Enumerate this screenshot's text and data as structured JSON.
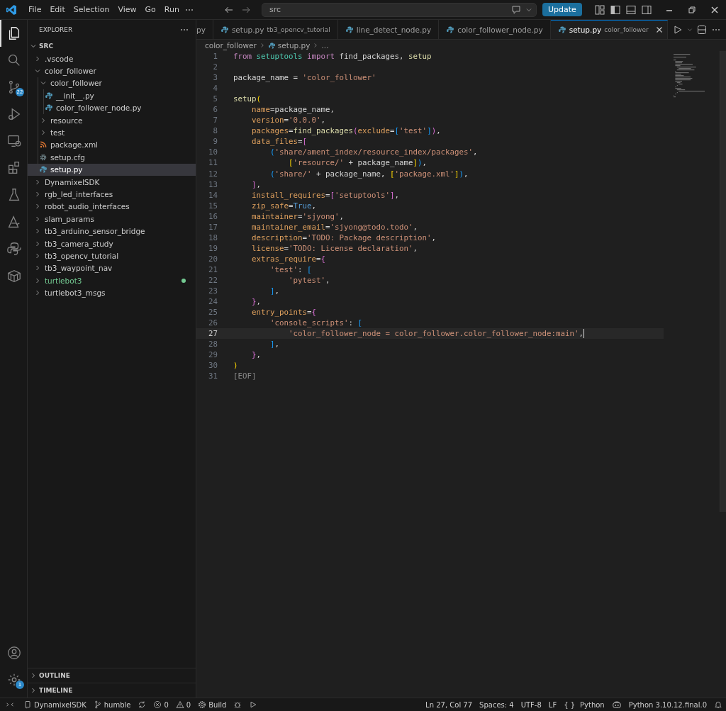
{
  "menu": [
    "File",
    "Edit",
    "Selection",
    "View",
    "Go",
    "Run"
  ],
  "command_center": {
    "value": "src"
  },
  "update_button": "Update",
  "activity_bar": {
    "top": [
      {
        "kind": "explorer",
        "selected": true
      },
      {
        "kind": "search",
        "selected": false
      },
      {
        "kind": "source-control",
        "selected": false,
        "badge": "22"
      },
      {
        "kind": "run-debug",
        "selected": false
      },
      {
        "kind": "remote",
        "selected": false
      },
      {
        "kind": "extensions",
        "selected": false
      },
      {
        "kind": "testing",
        "selected": false
      },
      {
        "kind": "ai",
        "selected": false
      },
      {
        "kind": "python",
        "selected": false
      },
      {
        "kind": "container",
        "selected": false
      }
    ],
    "bottom": [
      {
        "kind": "account",
        "selected": false
      },
      {
        "kind": "settings",
        "selected": false,
        "badge": "1"
      }
    ]
  },
  "explorer": {
    "title": "EXPLORER",
    "section": "SRC",
    "expanded": true,
    "items": [
      {
        "label": ".vscode",
        "kind": "folder",
        "expanded": false,
        "selected": false,
        "modified": false
      },
      {
        "label": "color_follower",
        "kind": "folder",
        "expanded": true,
        "selected": false,
        "modified": false,
        "children": [
          {
            "label": "color_follower",
            "kind": "folder",
            "expanded": true,
            "selected": false,
            "modified": false,
            "children": [
              {
                "label": "__init__.py",
                "kind": "python",
                "selected": false,
                "modified": false
              },
              {
                "label": "color_follower_node.py",
                "kind": "python",
                "selected": false,
                "modified": false
              }
            ]
          },
          {
            "label": "resource",
            "kind": "folder",
            "expanded": false,
            "selected": false,
            "modified": false
          },
          {
            "label": "test",
            "kind": "folder",
            "expanded": false,
            "selected": false,
            "modified": false
          },
          {
            "label": "package.xml",
            "kind": "xml",
            "selected": false,
            "modified": false
          },
          {
            "label": "setup.cfg",
            "kind": "config",
            "selected": false,
            "modified": false
          },
          {
            "label": "setup.py",
            "kind": "python",
            "selected": true,
            "modified": false
          }
        ]
      },
      {
        "label": "DynamixelSDK",
        "kind": "folder",
        "expanded": false,
        "selected": false,
        "modified": false
      },
      {
        "label": "rgb_led_interfaces",
        "kind": "folder",
        "expanded": false,
        "selected": false,
        "modified": false
      },
      {
        "label": "robot_audio_interfaces",
        "kind": "folder",
        "expanded": false,
        "selected": false,
        "modified": false
      },
      {
        "label": "slam_params",
        "kind": "folder",
        "expanded": false,
        "selected": false,
        "modified": false
      },
      {
        "label": "tb3_arduino_sensor_bridge",
        "kind": "folder",
        "expanded": false,
        "selected": false,
        "modified": false
      },
      {
        "label": "tb3_camera_study",
        "kind": "folder",
        "expanded": false,
        "selected": false,
        "modified": false
      },
      {
        "label": "tb3_opencv_tutorial",
        "kind": "folder",
        "expanded": false,
        "selected": false,
        "modified": false
      },
      {
        "label": "tb3_waypoint_nav",
        "kind": "folder",
        "expanded": false,
        "selected": false,
        "modified": false
      },
      {
        "label": "turtlebot3",
        "kind": "folder",
        "expanded": false,
        "selected": false,
        "modified": true
      },
      {
        "label": "turtlebot3_msgs",
        "kind": "folder",
        "expanded": false,
        "selected": false,
        "modified": false
      }
    ]
  },
  "panels": [
    {
      "label": "OUTLINE",
      "expanded": false
    },
    {
      "label": "TIMELINE",
      "expanded": false
    }
  ],
  "tabs": [
    {
      "label": "py",
      "icon": false,
      "selected": false
    },
    {
      "label": "setup.py",
      "description": "tb3_opencv_tutorial",
      "icon": true,
      "selected": false
    },
    {
      "label": "line_detect_node.py",
      "icon": true,
      "selected": false
    },
    {
      "label": "color_follower_node.py",
      "icon": true,
      "selected": false
    },
    {
      "label": "setup.py",
      "description": "color_follower",
      "icon": true,
      "selected": true
    }
  ],
  "breadcrumb": [
    "color_follower",
    "setup.py",
    "..."
  ],
  "code": [
    {
      "n": "1",
      "tokens": [
        {
          "t": "from ",
          "kind": "kw"
        },
        {
          "t": "setuptools ",
          "kind": "mod"
        },
        {
          "t": "import ",
          "kind": "kw"
        },
        {
          "t": "find_packages, ",
          "kind": "p"
        },
        {
          "t": "setup",
          "kind": "fn"
        }
      ]
    },
    {
      "n": "2"
    },
    {
      "n": "3",
      "tokens": [
        {
          "t": "package_name = ",
          "kind": "p"
        },
        {
          "t": "'color_follower'",
          "kind": "str"
        }
      ]
    },
    {
      "n": "4"
    },
    {
      "n": "5",
      "tokens": [
        {
          "t": "setup",
          "kind": "fn"
        },
        {
          "t": "(",
          "kind": "b1"
        }
      ]
    },
    {
      "n": "6",
      "tokens": [
        {
          "t": "    name",
          "kind": "param"
        },
        {
          "t": "=package_name,",
          "kind": "p"
        }
      ]
    },
    {
      "n": "7",
      "tokens": [
        {
          "t": "    version",
          "kind": "param"
        },
        {
          "t": "=",
          "kind": "p"
        },
        {
          "t": "'0.0.0'",
          "kind": "str"
        },
        {
          "t": ",",
          "kind": "p"
        }
      ]
    },
    {
      "n": "8",
      "tokens": [
        {
          "t": "    packages",
          "kind": "param"
        },
        {
          "t": "=",
          "kind": "p"
        },
        {
          "t": "find_packages",
          "kind": "fn"
        },
        {
          "t": "(",
          "kind": "b2"
        },
        {
          "t": "exclude",
          "kind": "param"
        },
        {
          "t": "=",
          "kind": "p"
        },
        {
          "t": "[",
          "kind": "b3"
        },
        {
          "t": "'test'",
          "kind": "str"
        },
        {
          "t": "]",
          "kind": "b3"
        },
        {
          "t": ")",
          "kind": "b2"
        },
        {
          "t": ",",
          "kind": "p"
        }
      ]
    },
    {
      "n": "9",
      "tokens": [
        {
          "t": "    data_files",
          "kind": "param"
        },
        {
          "t": "=",
          "kind": "p"
        },
        {
          "t": "[",
          "kind": "b2"
        }
      ]
    },
    {
      "n": "10",
      "tokens": [
        {
          "t": "        (",
          "kind": "b3"
        },
        {
          "t": "'share/ament_index/resource_index/packages'",
          "kind": "str"
        },
        {
          "t": ",",
          "kind": "p"
        }
      ]
    },
    {
      "n": "11",
      "tokens": [
        {
          "t": "            [",
          "kind": "b1"
        },
        {
          "t": "'resource/'",
          "kind": "str"
        },
        {
          "t": " + package_name",
          "kind": "p"
        },
        {
          "t": "]",
          "kind": "b1"
        },
        {
          "t": ")",
          "kind": "b3"
        },
        {
          "t": ",",
          "kind": "p"
        }
      ]
    },
    {
      "n": "12",
      "tokens": [
        {
          "t": "        (",
          "kind": "b3"
        },
        {
          "t": "'share/'",
          "kind": "str"
        },
        {
          "t": " + package_name, ",
          "kind": "p"
        },
        {
          "t": "[",
          "kind": "b1"
        },
        {
          "t": "'package.xml'",
          "kind": "str"
        },
        {
          "t": "]",
          "kind": "b1"
        },
        {
          "t": ")",
          "kind": "b3"
        },
        {
          "t": ",",
          "kind": "p"
        }
      ]
    },
    {
      "n": "13",
      "tokens": [
        {
          "t": "    ]",
          "kind": "b2"
        },
        {
          "t": ",",
          "kind": "p"
        }
      ]
    },
    {
      "n": "14",
      "tokens": [
        {
          "t": "    install_requires",
          "kind": "param"
        },
        {
          "t": "=",
          "kind": "p"
        },
        {
          "t": "[",
          "kind": "b2"
        },
        {
          "t": "'setuptools'",
          "kind": "str"
        },
        {
          "t": "]",
          "kind": "b2"
        },
        {
          "t": ",",
          "kind": "p"
        }
      ]
    },
    {
      "n": "15",
      "tokens": [
        {
          "t": "    zip_safe",
          "kind": "param"
        },
        {
          "t": "=",
          "kind": "p"
        },
        {
          "t": "True",
          "kind": "const"
        },
        {
          "t": ",",
          "kind": "p"
        }
      ]
    },
    {
      "n": "16",
      "tokens": [
        {
          "t": "    maintainer",
          "kind": "param"
        },
        {
          "t": "=",
          "kind": "p"
        },
        {
          "t": "'sjyong'",
          "kind": "str"
        },
        {
          "t": ",",
          "kind": "p"
        }
      ]
    },
    {
      "n": "17",
      "tokens": [
        {
          "t": "    maintainer_email",
          "kind": "param"
        },
        {
          "t": "=",
          "kind": "p"
        },
        {
          "t": "'sjyong@todo.todo'",
          "kind": "str"
        },
        {
          "t": ",",
          "kind": "p"
        }
      ]
    },
    {
      "n": "18",
      "tokens": [
        {
          "t": "    description",
          "kind": "param"
        },
        {
          "t": "=",
          "kind": "p"
        },
        {
          "t": "'TODO: Package description'",
          "kind": "str"
        },
        {
          "t": ",",
          "kind": "p"
        }
      ]
    },
    {
      "n": "19",
      "tokens": [
        {
          "t": "    license",
          "kind": "param"
        },
        {
          "t": "=",
          "kind": "p"
        },
        {
          "t": "'TODO: License declaration'",
          "kind": "str"
        },
        {
          "t": ",",
          "kind": "p"
        }
      ]
    },
    {
      "n": "20",
      "tokens": [
        {
          "t": "    extras_require",
          "kind": "param"
        },
        {
          "t": "=",
          "kind": "p"
        },
        {
          "t": "{",
          "kind": "b2"
        }
      ]
    },
    {
      "n": "21",
      "tokens": [
        {
          "t": "        'test'",
          "kind": "str"
        },
        {
          "t": ": ",
          "kind": "p"
        },
        {
          "t": "[",
          "kind": "b3"
        }
      ]
    },
    {
      "n": "22",
      "tokens": [
        {
          "t": "            'pytest'",
          "kind": "str"
        },
        {
          "t": ",",
          "kind": "p"
        }
      ]
    },
    {
      "n": "23",
      "tokens": [
        {
          "t": "        ]",
          "kind": "b3"
        },
        {
          "t": ",",
          "kind": "p"
        }
      ]
    },
    {
      "n": "24",
      "tokens": [
        {
          "t": "    }",
          "kind": "b2"
        },
        {
          "t": ",",
          "kind": "p"
        }
      ]
    },
    {
      "n": "25",
      "tokens": [
        {
          "t": "    entry_points",
          "kind": "param"
        },
        {
          "t": "=",
          "kind": "p"
        },
        {
          "t": "{",
          "kind": "b2"
        }
      ]
    },
    {
      "n": "26",
      "tokens": [
        {
          "t": "        'console_scripts'",
          "kind": "str"
        },
        {
          "t": ": ",
          "kind": "p"
        },
        {
          "t": "[",
          "kind": "b3"
        }
      ]
    },
    {
      "n": "27",
      "current": true,
      "tokens": [
        {
          "t": "            'color_follower_node = color_follower.color_follower_node:main'",
          "kind": "str"
        },
        {
          "t": ",",
          "kind": "p"
        }
      ]
    },
    {
      "n": "28",
      "tokens": [
        {
          "t": "        ]",
          "kind": "b3"
        },
        {
          "t": ",",
          "kind": "p"
        }
      ]
    },
    {
      "n": "29",
      "tokens": [
        {
          "t": "    }",
          "kind": "b2"
        },
        {
          "t": ",",
          "kind": "p"
        }
      ]
    },
    {
      "n": "30",
      "tokens": [
        {
          "t": ")",
          "kind": "b1"
        }
      ]
    },
    {
      "n": "31",
      "tokens": [
        {
          "t": "[EOF]",
          "kind": "eof"
        }
      ]
    }
  ],
  "status_bar": {
    "left": [
      {
        "kind": "remote"
      },
      {
        "kind": "folder",
        "text": "DynamixelSDK"
      },
      {
        "kind": "branch",
        "text": "humble"
      },
      {
        "kind": "sync"
      },
      {
        "kind": "errors",
        "text": "0"
      },
      {
        "kind": "warnings",
        "text": "0"
      },
      {
        "kind": "build",
        "text": "Build"
      },
      {
        "kind": "debug"
      },
      {
        "kind": "run"
      }
    ],
    "right": [
      {
        "kind": "text",
        "text": "Ln 27, Col 77"
      },
      {
        "kind": "text",
        "text": "Spaces: 4"
      },
      {
        "kind": "text",
        "text": "UTF-8"
      },
      {
        "kind": "text",
        "text": "LF"
      },
      {
        "kind": "language",
        "brace": "{ }",
        "text": "Python"
      },
      {
        "kind": "copilot"
      },
      {
        "kind": "text",
        "text": "Python 3.10.12.final.0"
      },
      {
        "kind": "bell"
      }
    ]
  }
}
